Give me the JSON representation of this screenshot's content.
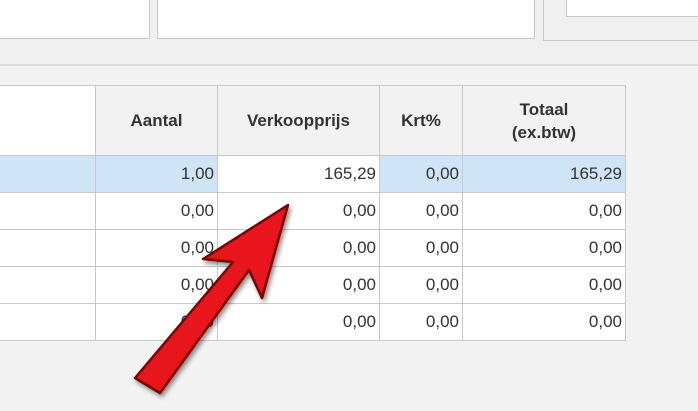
{
  "grid": {
    "columns": [
      {
        "label": ""
      },
      {
        "label": "Aantal"
      },
      {
        "label": "Verkoopprijs"
      },
      {
        "label": "Krt%"
      },
      {
        "label": "Totaal (ex.btw)"
      }
    ],
    "rows": [
      {
        "aantal": "1,00",
        "verkoopprijs": "165,29",
        "krt": "0,00",
        "totaal": "165,29",
        "selected": true
      },
      {
        "aantal": "0,00",
        "verkoopprijs": "0,00",
        "krt": "0,00",
        "totaal": "0,00"
      },
      {
        "aantal": "0,00",
        "verkoopprijs": "0,00",
        "krt": "0,00",
        "totaal": "0,00"
      },
      {
        "aantal": "0,00",
        "verkoopprijs": "0,00",
        "krt": "0,00",
        "totaal": "0,00"
      },
      {
        "aantal": "0,00",
        "verkoopprijs": "0,00",
        "krt": "0,00",
        "totaal": "0,00"
      }
    ]
  },
  "annotation": {
    "icon": "red-arrow-icon",
    "color": "#e8141b"
  }
}
